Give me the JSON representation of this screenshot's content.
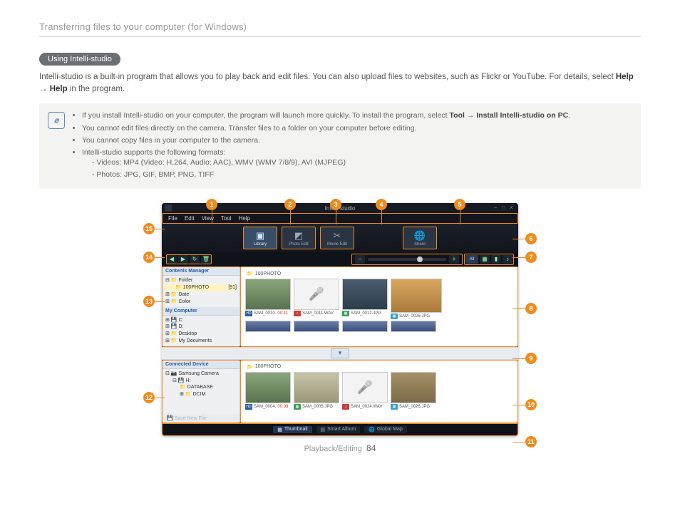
{
  "page": {
    "breadcrumb": "Transferring files to your computer (for Windows)",
    "section_label": "Using Intelli-studio",
    "intro_a": "Intelli-studio is a built-in program that allows you to play back and edit files. You can also upload files to websites, such as Flickr or YouTube. For details, select ",
    "intro_help1": "Help",
    "intro_arrow": " → ",
    "intro_help2": "Help",
    "intro_b": " in the program.",
    "footer_section": "Playback/Editing",
    "footer_page": "84"
  },
  "note": {
    "b1a": "If you install Intelli-studio on your computer, the program will launch more quickly. To install the program, select ",
    "b1_tool": "Tool",
    "b1_arrow": " → ",
    "b1_inst": "Install Intelli-studio on PC",
    "b1b": ".",
    "b2": "You cannot edit files directly on the camera. Transfer files to a folder on your computer before editing.",
    "b3": "You cannot copy files in your computer to the camera.",
    "b4": "Intelli-studio supports the following formats:",
    "b4a": "Videos: MP4 (Video: H.264, Audio: AAC), WMV (WMV 7/8/9), AVI (MJPEG)",
    "b4b": "Photos: JPG, GIF, BMP, PNG, TIFF"
  },
  "callouts": {
    "c1": "1",
    "c2": "2",
    "c3": "3",
    "c4": "4",
    "c5": "5",
    "c6": "6",
    "c7": "7",
    "c8": "8",
    "c9": "9",
    "c10": "10",
    "c11": "11",
    "c12": "12",
    "c13": "13",
    "c14": "14",
    "c15": "15"
  },
  "app": {
    "title": "Intelli-studio",
    "menus": {
      "file": "File",
      "edit": "Edit",
      "view": "View",
      "tool": "Tool",
      "help": "Help"
    },
    "tabs": {
      "library": "Library",
      "photo": "Photo Edit",
      "movie": "Movie Edit",
      "share": "Share"
    },
    "toolbar": {
      "all": "All"
    },
    "panels": {
      "contents_hdr": "Contents Manager",
      "folder": "Folder",
      "folder_100": "100PHOTO",
      "folder_count": "[91]",
      "date": "Date",
      "color": "Color",
      "mycomp_hdr": "My Computer",
      "drive_c": "C:",
      "drive_d": "D:",
      "desktop": "Desktop",
      "mydocs": "My Documents",
      "conn_hdr": "Connected Device",
      "samsung": "Samsung Camera",
      "drive_h": "H:",
      "database": "DATABASE",
      "dcim": "DCIM",
      "save": "Save New File"
    },
    "folderbar": {
      "label": "100PHOTO"
    },
    "thumbs_top": {
      "t1": "SAM_0010.",
      "t1time": "00:11",
      "t2": "SAM_0011.WAV",
      "t3": "SAM_0012.JPG",
      "t4": "SAM_0026.JPG"
    },
    "thumbs_bot": {
      "t1": "SAM_0004.",
      "t1time": "00:08",
      "t2": "SAM_0005.JPG",
      "t3": "SAM_0024.WAV",
      "t4": "SAM_0026.JPG"
    },
    "bottombar": {
      "thumb": "Thumbnail",
      "smart": "Smart Album",
      "map": "Global Map"
    }
  }
}
